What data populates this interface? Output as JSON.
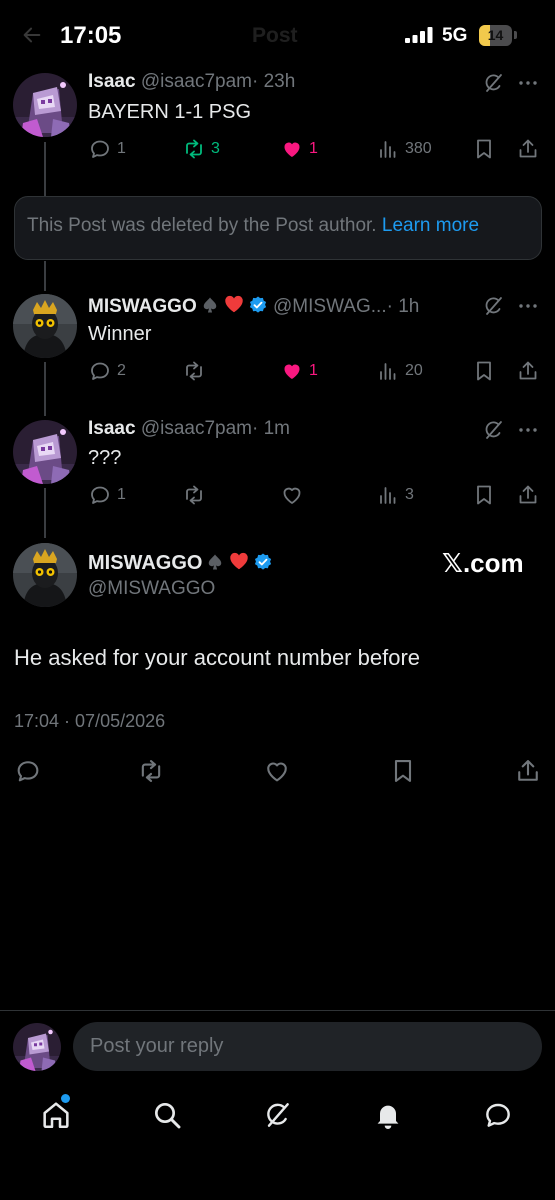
{
  "status_bar": {
    "time": "17:05",
    "network": "5G",
    "battery": "14",
    "battery_level_percent": 14
  },
  "header": {
    "title": "Post"
  },
  "posts": [
    {
      "name": "Isaac",
      "handle": "@isaac7pam",
      "time": "· 23h",
      "text": "BAYERN 1-1 PSG",
      "replies": "1",
      "reposts": "3",
      "likes": "1",
      "views": "380"
    },
    {
      "name": "MISWAGGO",
      "handle": "@MISWAG...",
      "time": "· 1h",
      "text": "Winner",
      "replies": "2",
      "reposts": "",
      "likes": "1",
      "views": "20"
    },
    {
      "name": "Isaac",
      "handle": "@isaac7pam",
      "time": "· 1m",
      "text": "???",
      "replies": "1",
      "reposts": "",
      "likes": "",
      "views": "3"
    }
  ],
  "deleted_notice": {
    "text": "This Post was deleted by the Post author.",
    "link": "Learn more"
  },
  "main_post": {
    "name": "MISWAGGO",
    "handle": "@MISWAGGO",
    "watermark": "𝕏.com",
    "text": "He asked for your account number before",
    "timestamp": "17:04 · 07/05/2026"
  },
  "reply": {
    "placeholder": "Post your reply"
  },
  "colors": {
    "background": "#000000",
    "accent": "#1d9bf0",
    "repost_green": "#00ba7c",
    "like_pink": "#f91880",
    "muted": "#71767b"
  },
  "icons": {
    "status": [
      "signal-icon",
      "battery-icon"
    ],
    "post_actions": [
      "reply-icon",
      "repost-icon",
      "like-icon",
      "views-icon",
      "bookmark-icon",
      "share-icon"
    ],
    "post_menu": [
      "grok-icon",
      "more-icon"
    ],
    "bottom_nav": [
      "home-icon",
      "search-icon",
      "grok-icon",
      "notifications-icon",
      "messages-icon"
    ]
  }
}
